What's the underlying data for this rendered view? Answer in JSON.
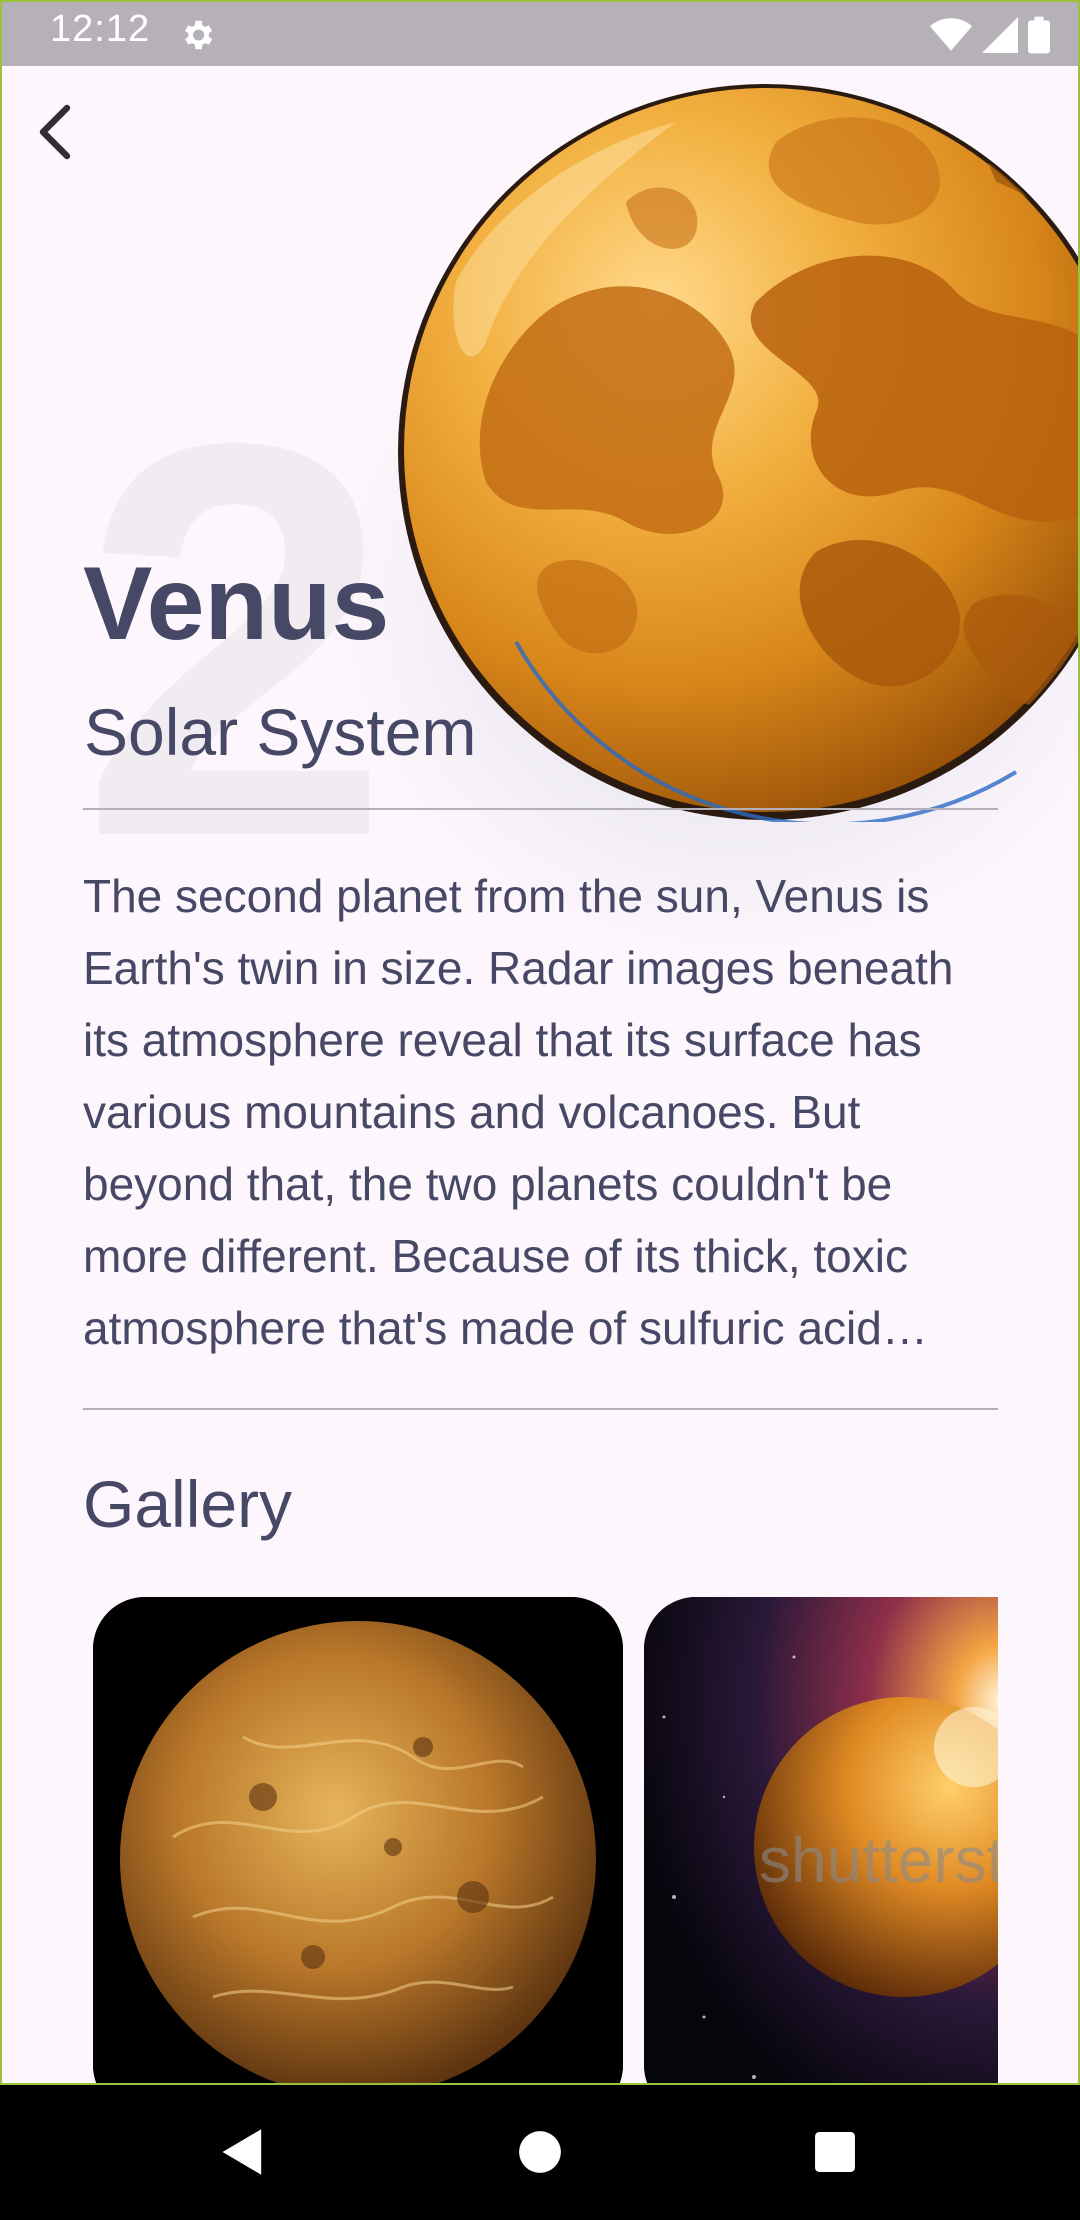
{
  "status_bar": {
    "time": "12:12",
    "icons": [
      "gear-icon",
      "wifi-icon",
      "signal-icon",
      "battery-icon"
    ]
  },
  "header": {
    "back_icon": "chevron-left-icon"
  },
  "planet": {
    "position_number": "2",
    "name": "Venus",
    "system": "Solar System",
    "description": "The second planet from the sun, Venus is Earth's twin in size. Radar images beneath its atmosphere reveal that its surface has various mountains and volcanoes. But beyond that, the two planets couldn't be more different. Because of its thick, toxic atmosphere that's made of sulfuric acid clouds, Venus is an extreme example of the greenhouse effect."
  },
  "gallery": {
    "title": "Gallery",
    "items": [
      {
        "name": "venus-radar-photo"
      },
      {
        "name": "venus-space-photo",
        "watermark": "shutterstock"
      }
    ]
  },
  "nav_bar": {
    "icons": [
      "back-triangle-icon",
      "home-circle-icon",
      "recents-square-icon"
    ]
  },
  "colors": {
    "text": "#464866",
    "background": "#fdf6fc",
    "status_bar": "#b6b0b8",
    "planet_orange": "#d8901e"
  }
}
